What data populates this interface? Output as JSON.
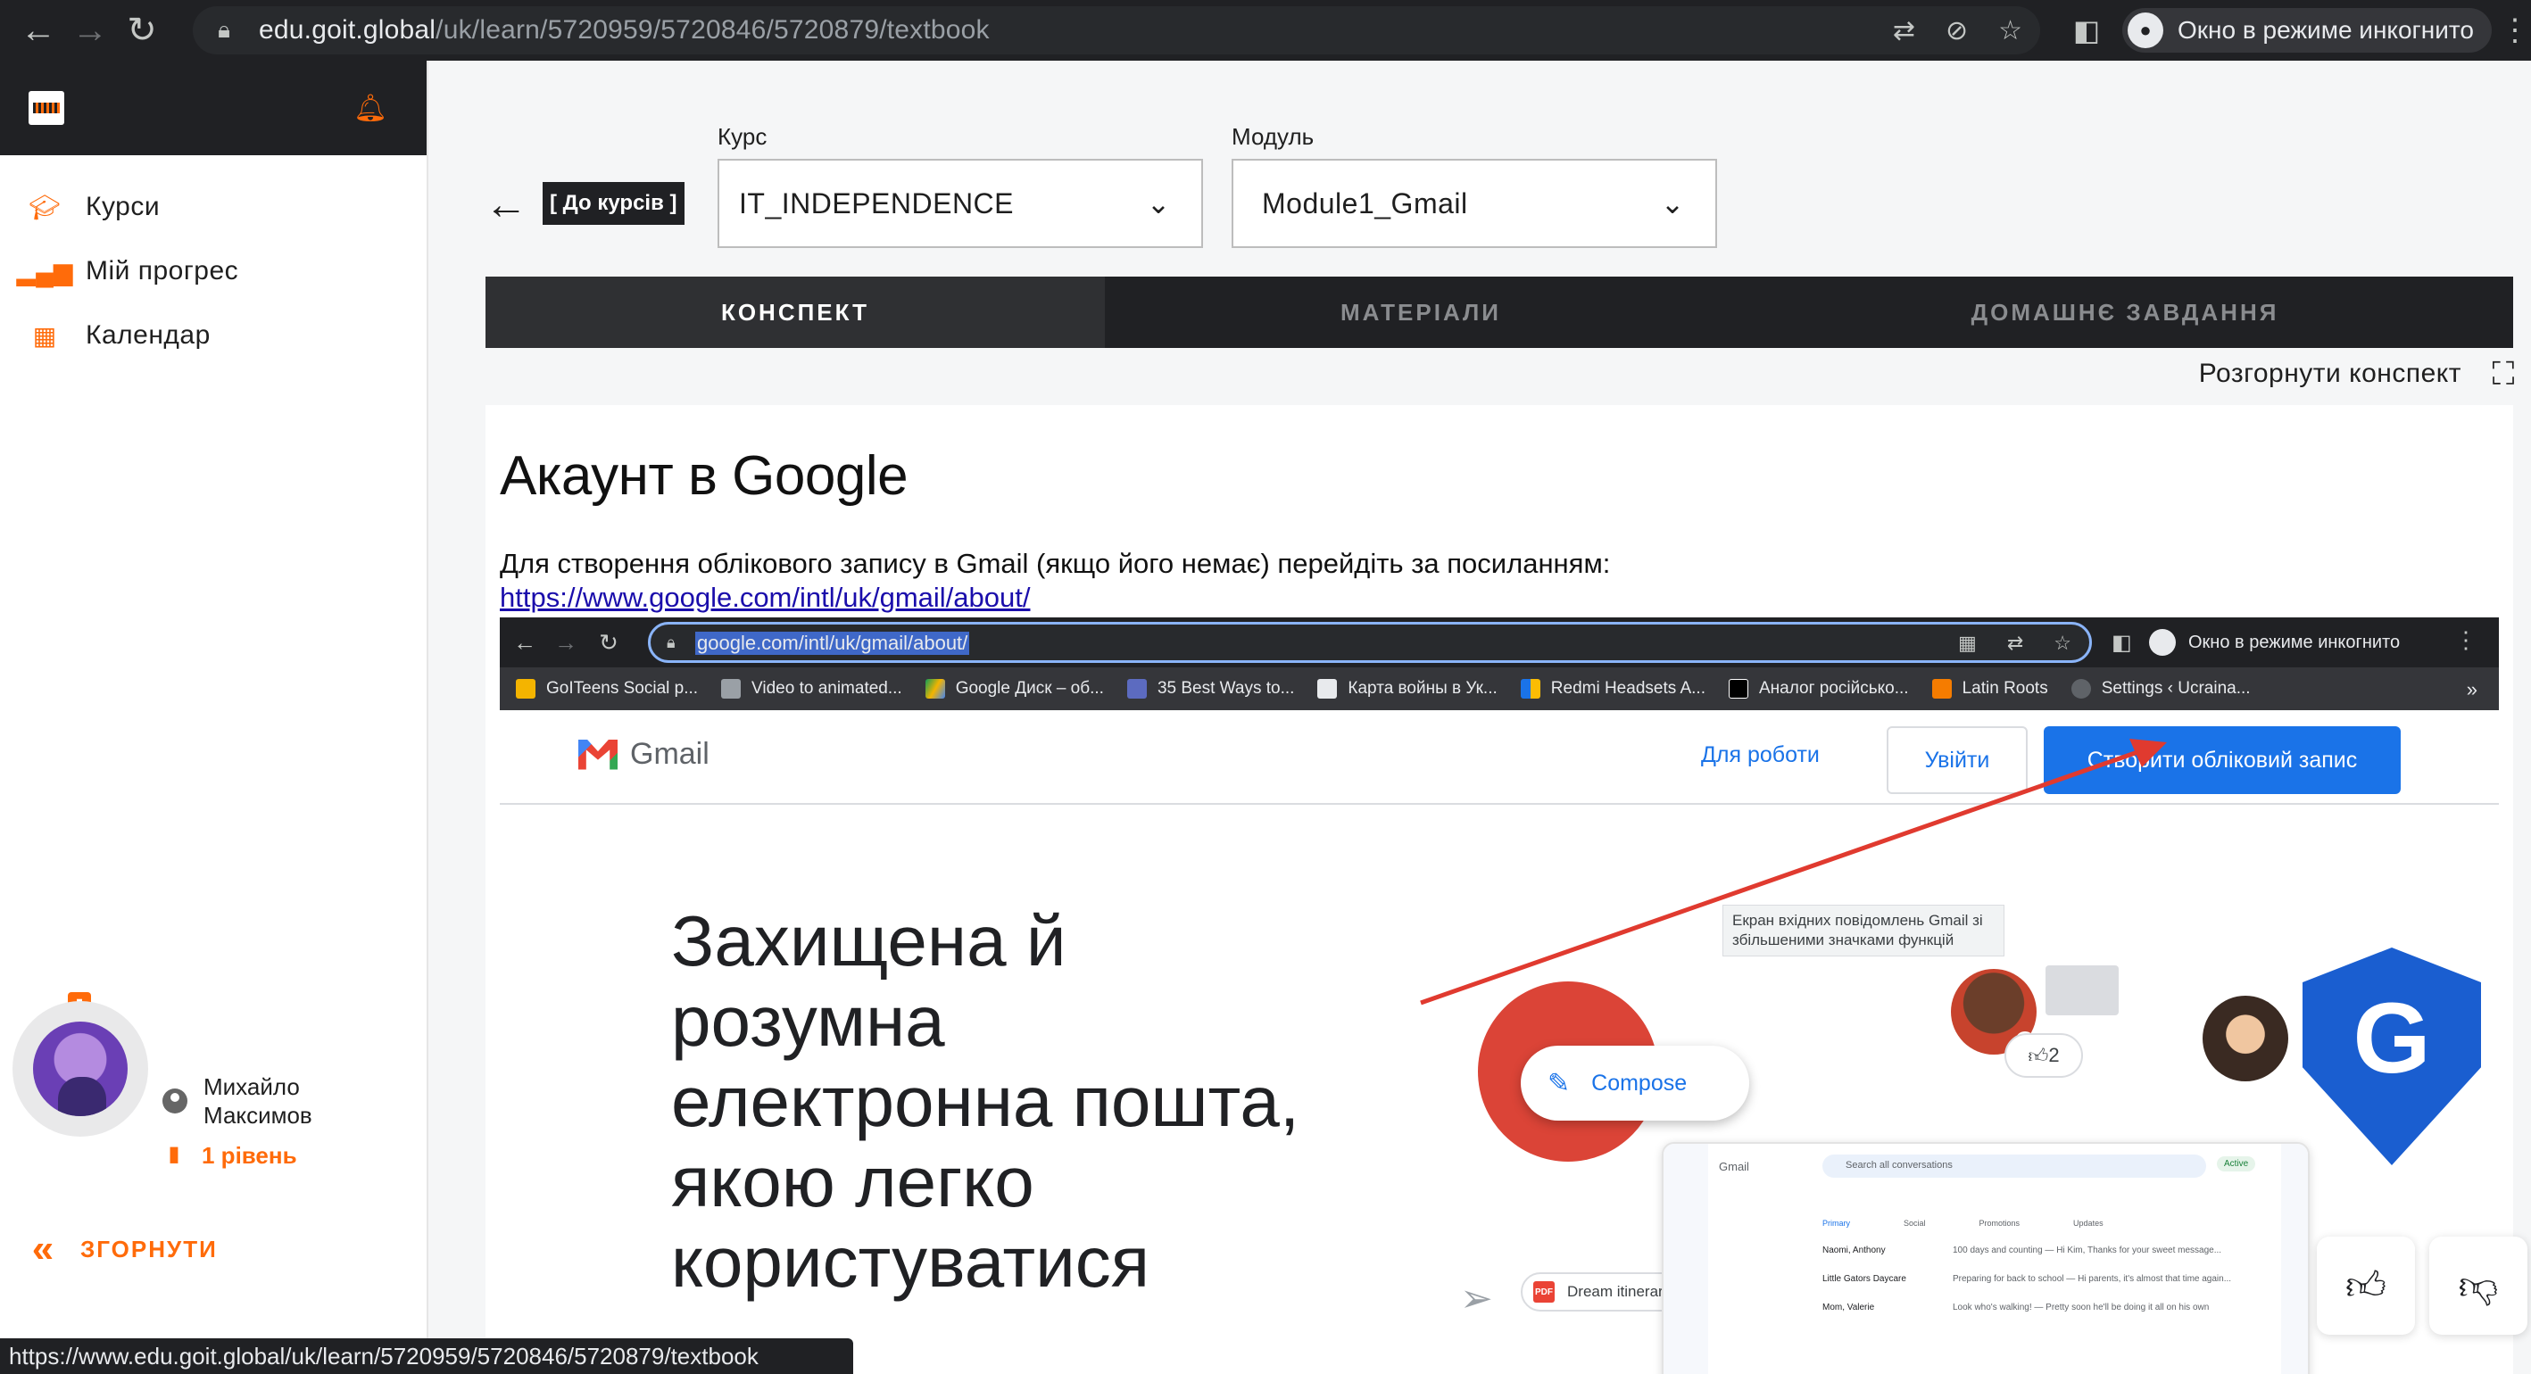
{
  "browser": {
    "url_host": "edu.goit.global",
    "url_path": "/uk/learn/5720959/5720846/5720879/textbook",
    "incognito_label": "Окно в режиме инкогнито"
  },
  "sidebar": {
    "items": [
      {
        "label": "Курси",
        "icon": "graduation-cap-icon"
      },
      {
        "label": "Мій прогрес",
        "icon": "bar-chart-icon"
      },
      {
        "label": "Календар",
        "icon": "calendar-icon"
      }
    ],
    "profile": {
      "name": "Михайло Максимов",
      "level": "1 рівень"
    },
    "collapse_label": "ЗГОРНУТИ"
  },
  "header": {
    "back_label": "[ До курсів ]",
    "course_label": "Курс",
    "course_value": "IT_INDEPENDENCE",
    "module_label": "Модуль",
    "module_value": "Module1_Gmail"
  },
  "tabs": [
    {
      "label": "КОНСПЕКТ",
      "active": true
    },
    {
      "label": "МАТЕРІАЛИ",
      "active": false
    },
    {
      "label": "ДОМАШНЄ ЗАВДАННЯ",
      "active": false
    }
  ],
  "expand_label": "Розгорнути конспект",
  "content": {
    "title": "Акаунт в Google",
    "paragraph": "Для створення облікового запису в Gmail (якщо його немає) перейдіть за посиланням:",
    "link": "https://www.google.com/intl/uk/gmail/about/"
  },
  "shot": {
    "url": "google.com/intl/uk/gmail/about/",
    "incognito": "Окно в режиме инкогнито",
    "bookmarks": [
      "GoITeens Social p...",
      "Video to animated...",
      "Google Диск – об...",
      "35 Best Ways to...",
      "Карта войны в Ук...",
      "Redmi Headsets A...",
      "Аналог російсько...",
      "Latin Roots",
      "Settings ‹ Ucraina..."
    ],
    "bookmark_more": "»",
    "gmail_logo": "Gmail",
    "work": "Для роботи",
    "login": "Увійти",
    "create": "Створити обліковий запис",
    "hero": "Захищена й розумна електронна пошта, якою легко користуватися",
    "tooltip": "Екран вхідних повідомлень Gmail зі збільшеними значками функцій",
    "compose": "Compose",
    "reaction_count": "2",
    "dream": "Dream itinerary",
    "pdf": "PDF",
    "mini": {
      "logo": "Gmail",
      "search": "Search all conversations",
      "active": "Active",
      "tabs": [
        "Primary",
        "Social",
        "Promotions",
        "Updates"
      ],
      "rows": [
        {
          "sender": "Naomi, Anthony",
          "body": "100 days and counting — Hi Kim, Thanks for your sweet message..."
        },
        {
          "sender": "Little Gators Daycare",
          "body": "Preparing for back to school — Hi parents, it's almost that time again..."
        },
        {
          "sender": "Mom, Valerie",
          "body": "Look who's walking! — Pretty soon he'll be doing it all on his own"
        }
      ]
    }
  },
  "status_url": "https://www.edu.goit.global/uk/learn/5720959/5720846/5720879/textbook"
}
